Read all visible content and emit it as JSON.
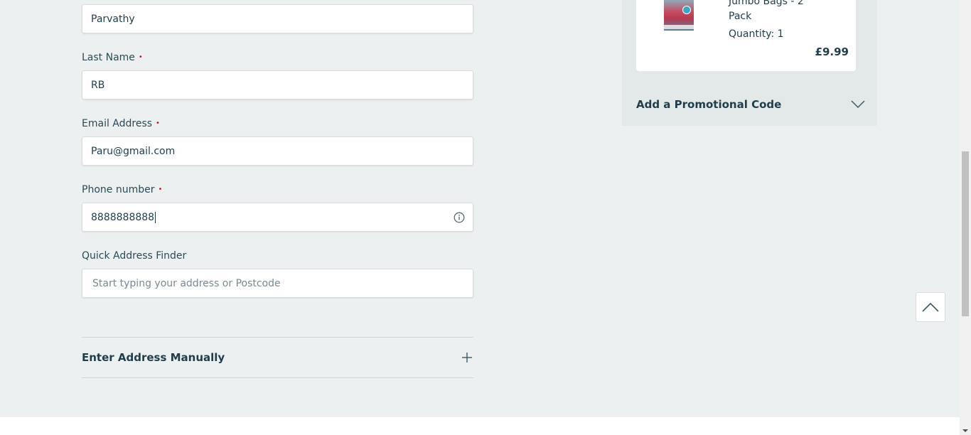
{
  "form": {
    "first_name": {
      "value": "Parvathy"
    },
    "last_name": {
      "label": "Last Name",
      "required_marker": "•",
      "value": "RB"
    },
    "email": {
      "label": "Email Address",
      "required_marker": "•",
      "value": "Paru@gmail.com"
    },
    "phone": {
      "label": "Phone number",
      "required_marker": "•",
      "value": "8888888888",
      "icon": "info-icon"
    },
    "address_finder": {
      "label": "Quick Address Finder",
      "placeholder": "Start typing your address or Postcode"
    },
    "manual_address": {
      "label": "Enter Address Manually",
      "icon": "plus-icon"
    }
  },
  "order_summary": {
    "product": {
      "name_line1": "Jumbo Bags - 2",
      "name_line2": "Pack",
      "quantity": "Quantity: 1",
      "price": "£9.99"
    },
    "promo": {
      "label": "Add a Promotional Code",
      "icon": "chevron-down-icon"
    }
  },
  "back_to_top": {
    "icon": "chevron-up-icon"
  },
  "colors": {
    "page_bg": "#edf0f0",
    "panel_bg": "#e3e8e9",
    "text_primary": "#1f3d4a",
    "required_marker": "#c8102e"
  }
}
